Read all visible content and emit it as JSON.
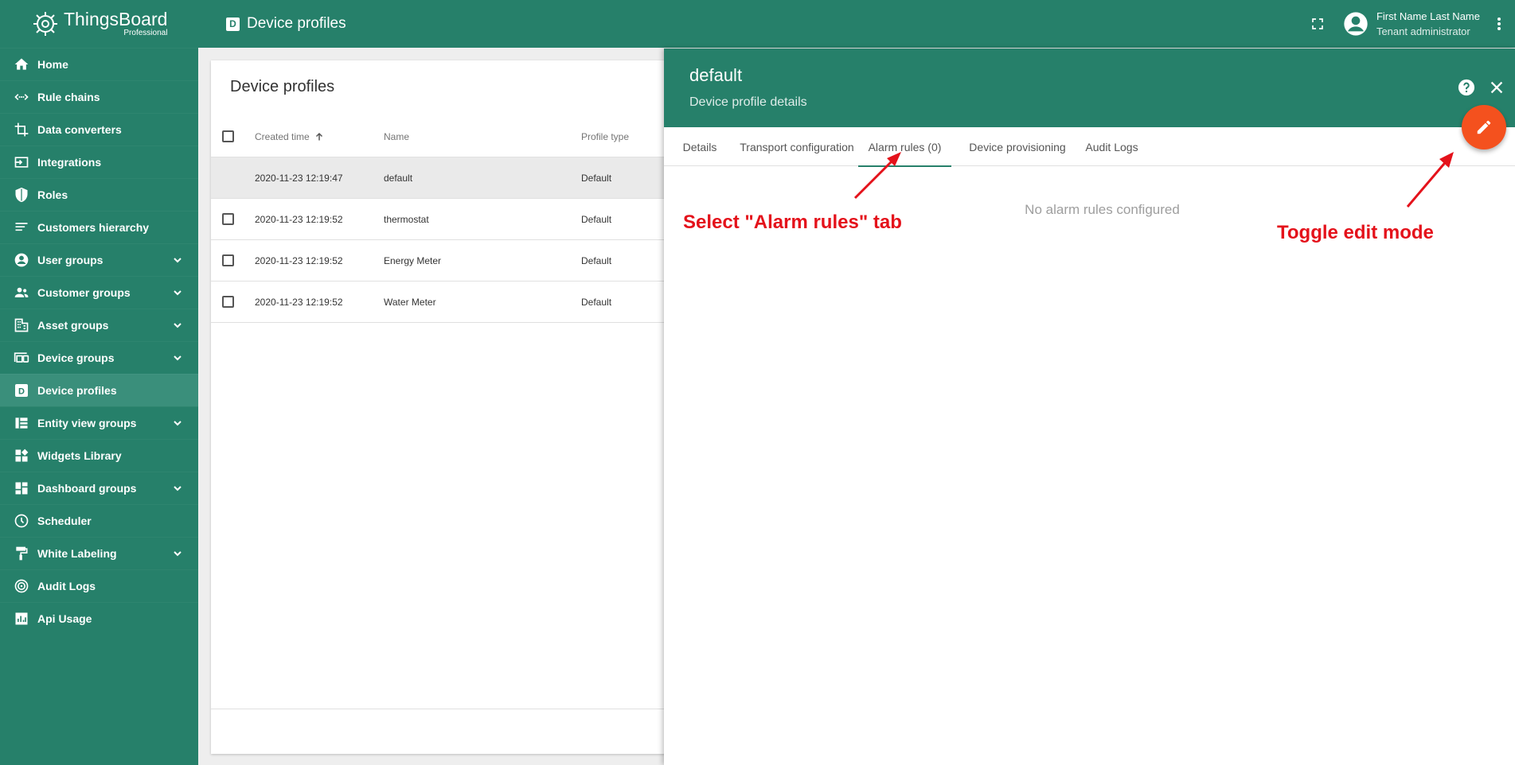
{
  "app": {
    "logo_title": "ThingsBoard",
    "logo_subtitle": "Professional"
  },
  "sidebar": {
    "items": [
      {
        "label": "Home",
        "icon": "home-icon"
      },
      {
        "label": "Rule chains",
        "icon": "rule-chains-icon"
      },
      {
        "label": "Data converters",
        "icon": "data-converters-icon"
      },
      {
        "label": "Integrations",
        "icon": "integrations-icon"
      },
      {
        "label": "Roles",
        "icon": "roles-icon"
      },
      {
        "label": "Customers hierarchy",
        "icon": "customers-hierarchy-icon"
      },
      {
        "label": "User groups",
        "icon": "user-groups-icon"
      },
      {
        "label": "Customer groups",
        "icon": "customer-groups-icon"
      },
      {
        "label": "Asset groups",
        "icon": "asset-groups-icon"
      },
      {
        "label": "Device groups",
        "icon": "device-groups-icon"
      },
      {
        "label": "Device profiles",
        "icon": "device-profiles-icon"
      },
      {
        "label": "Entity view groups",
        "icon": "entity-view-groups-icon"
      },
      {
        "label": "Widgets Library",
        "icon": "widgets-library-icon"
      },
      {
        "label": "Dashboard groups",
        "icon": "dashboard-groups-icon"
      },
      {
        "label": "Scheduler",
        "icon": "scheduler-icon"
      },
      {
        "label": "White Labeling",
        "icon": "white-labeling-icon"
      },
      {
        "label": "Audit Logs",
        "icon": "audit-logs-icon"
      },
      {
        "label": "Api Usage",
        "icon": "api-usage-icon"
      }
    ]
  },
  "topbar": {
    "title_icon_letter": "D",
    "title": "Device profiles",
    "user_name": "First Name Last Name",
    "user_role": "Tenant administrator"
  },
  "card": {
    "title": "Device profiles",
    "columns": [
      "Created time",
      "Name",
      "Profile type"
    ],
    "rows": [
      {
        "time": "2020-11-23 12:19:47",
        "name": "default",
        "type": "Default"
      },
      {
        "time": "2020-11-23 12:19:52",
        "name": "thermostat",
        "type": "Default"
      },
      {
        "time": "2020-11-23 12:19:52",
        "name": "Energy Meter",
        "type": "Default"
      },
      {
        "time": "2020-11-23 12:19:52",
        "name": "Water Meter",
        "type": "Default"
      }
    ]
  },
  "panel": {
    "title": "default",
    "subtitle": "Device profile details",
    "tabs": [
      "Details",
      "Transport configuration",
      "Alarm rules (0)",
      "Device provisioning",
      "Audit Logs"
    ],
    "active_tab": "Alarm rules (0)",
    "empty_message": "No alarm rules configured"
  },
  "annotations": {
    "tab_hint": "Select \"Alarm rules\" tab",
    "edit_hint": "Toggle edit mode"
  },
  "colors": {
    "primary": "#26806a",
    "fab": "#f4511e",
    "annotation": "#e4121b"
  }
}
